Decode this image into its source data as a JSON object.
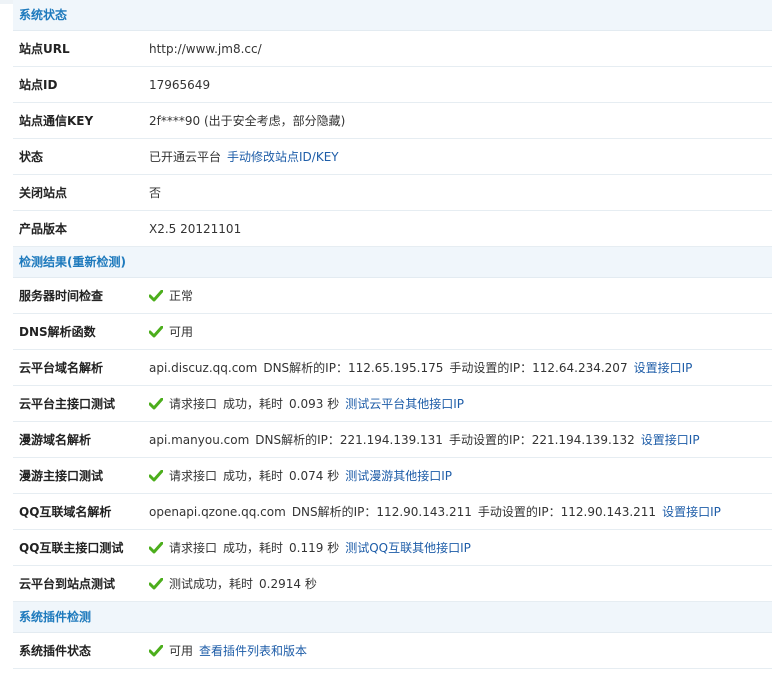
{
  "system_status": {
    "header": "系统状态",
    "rows": [
      {
        "label": "站点URL",
        "value": "http://www.jm8.cc/"
      },
      {
        "label": "站点ID",
        "value": "17965649"
      },
      {
        "label": "站点通信KEY",
        "value": "2f****90 (出于安全考虑，部分隐藏)"
      },
      {
        "label": "状态",
        "value": "已开通云平台",
        "link": "手动修改站点ID/KEY"
      },
      {
        "label": "关闭站点",
        "value": "否"
      },
      {
        "label": "产品版本",
        "value": "X2.5 20121101"
      }
    ]
  },
  "detection": {
    "header": "检测结果(重新检测)",
    "rows": [
      {
        "label": "服务器时间检查",
        "status": "正常"
      },
      {
        "label": "DNS解析函数",
        "status": "可用"
      },
      {
        "label": "云平台域名解析",
        "domain": "api.discuz.qq.com",
        "dns_ip": "DNS解析的IP：112.65.195.175",
        "manual_ip": "手动设置的IP：112.64.234.207",
        "link": "设置接口IP"
      },
      {
        "label": "云平台主接口测试",
        "text": "请求接口",
        "result": "成功，耗时",
        "time": "0.093 秒",
        "link": "测试云平台其他接口IP"
      },
      {
        "label": "漫游域名解析",
        "domain": "api.manyou.com",
        "dns_ip": "DNS解析的IP：221.194.139.131",
        "manual_ip": "手动设置的IP：221.194.139.132",
        "link": "设置接口IP"
      },
      {
        "label": "漫游主接口测试",
        "text": "请求接口",
        "result": "成功，耗时",
        "time": "0.074 秒",
        "link": "测试漫游其他接口IP"
      },
      {
        "label": "QQ互联域名解析",
        "domain": "openapi.qzone.qq.com",
        "dns_ip": "DNS解析的IP：112.90.143.211",
        "manual_ip": "手动设置的IP：112.90.143.211",
        "link": "设置接口IP"
      },
      {
        "label": "QQ互联主接口测试",
        "text": "请求接口",
        "result": "成功，耗时",
        "time": "0.119 秒",
        "link": "测试QQ互联其他接口IP"
      },
      {
        "label": "云平台到站点测试",
        "result": "测试成功，耗时",
        "time": "0.2914 秒"
      }
    ]
  },
  "plugins": {
    "header": "系统插件检测",
    "rows": [
      {
        "label": "系统插件状态",
        "status": "可用",
        "link": "查看插件列表和版本"
      }
    ]
  },
  "icons": {
    "check": "check-icon"
  },
  "colors": {
    "check_green": "#4cae1c",
    "link_blue": "#1e5da8",
    "header_blue": "#1e7abd"
  }
}
